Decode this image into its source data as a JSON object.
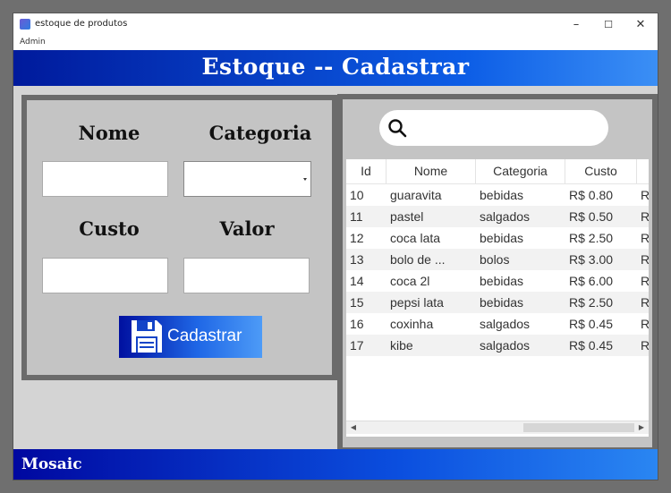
{
  "window": {
    "title": "estoque de produtos",
    "controls": {
      "minimize": "–",
      "maximize": "☐",
      "close": "✕"
    }
  },
  "menu": {
    "admin": "Admin"
  },
  "header": {
    "title": "Estoque -- Cadastrar"
  },
  "form": {
    "nome_label": "Nome",
    "categoria_label": "Categoria",
    "custo_label": "Custo",
    "valor_label": "Valor",
    "nome_value": "",
    "categoria_value": "",
    "custo_value": "",
    "valor_value": "",
    "cadastrar_label": "Cadastrar"
  },
  "search": {
    "value": "",
    "icon": "search-icon"
  },
  "table": {
    "columns": [
      "Id",
      "Nome",
      "Categoria",
      "Custo"
    ],
    "partial_column": "R",
    "rows": [
      {
        "id": "10",
        "nome": "guaravita",
        "categoria": "bebidas",
        "custo": "R$ 0.80"
      },
      {
        "id": "11",
        "nome": "pastel",
        "categoria": "salgados",
        "custo": "R$ 0.50"
      },
      {
        "id": "12",
        "nome": "coca lata",
        "categoria": "bebidas",
        "custo": "R$ 2.50"
      },
      {
        "id": "13",
        "nome": "bolo de ...",
        "categoria": "bolos",
        "custo": "R$ 3.00"
      },
      {
        "id": "14",
        "nome": "coca 2l",
        "categoria": "bebidas",
        "custo": "R$ 6.00"
      },
      {
        "id": "15",
        "nome": "pepsi lata",
        "categoria": "bebidas",
        "custo": "R$ 2.50"
      },
      {
        "id": "16",
        "nome": "coxinha",
        "categoria": "salgados",
        "custo": "R$ 0.45"
      },
      {
        "id": "17",
        "nome": "kibe",
        "categoria": "salgados",
        "custo": "R$ 0.45"
      }
    ]
  },
  "footer": {
    "brand": "Mosaic"
  },
  "colors": {
    "accent_blue": "#0c5de6",
    "dark_blue": "#001a9c",
    "panel_gray": "#c4c4c4",
    "frame_gray": "#6b6b6b"
  }
}
